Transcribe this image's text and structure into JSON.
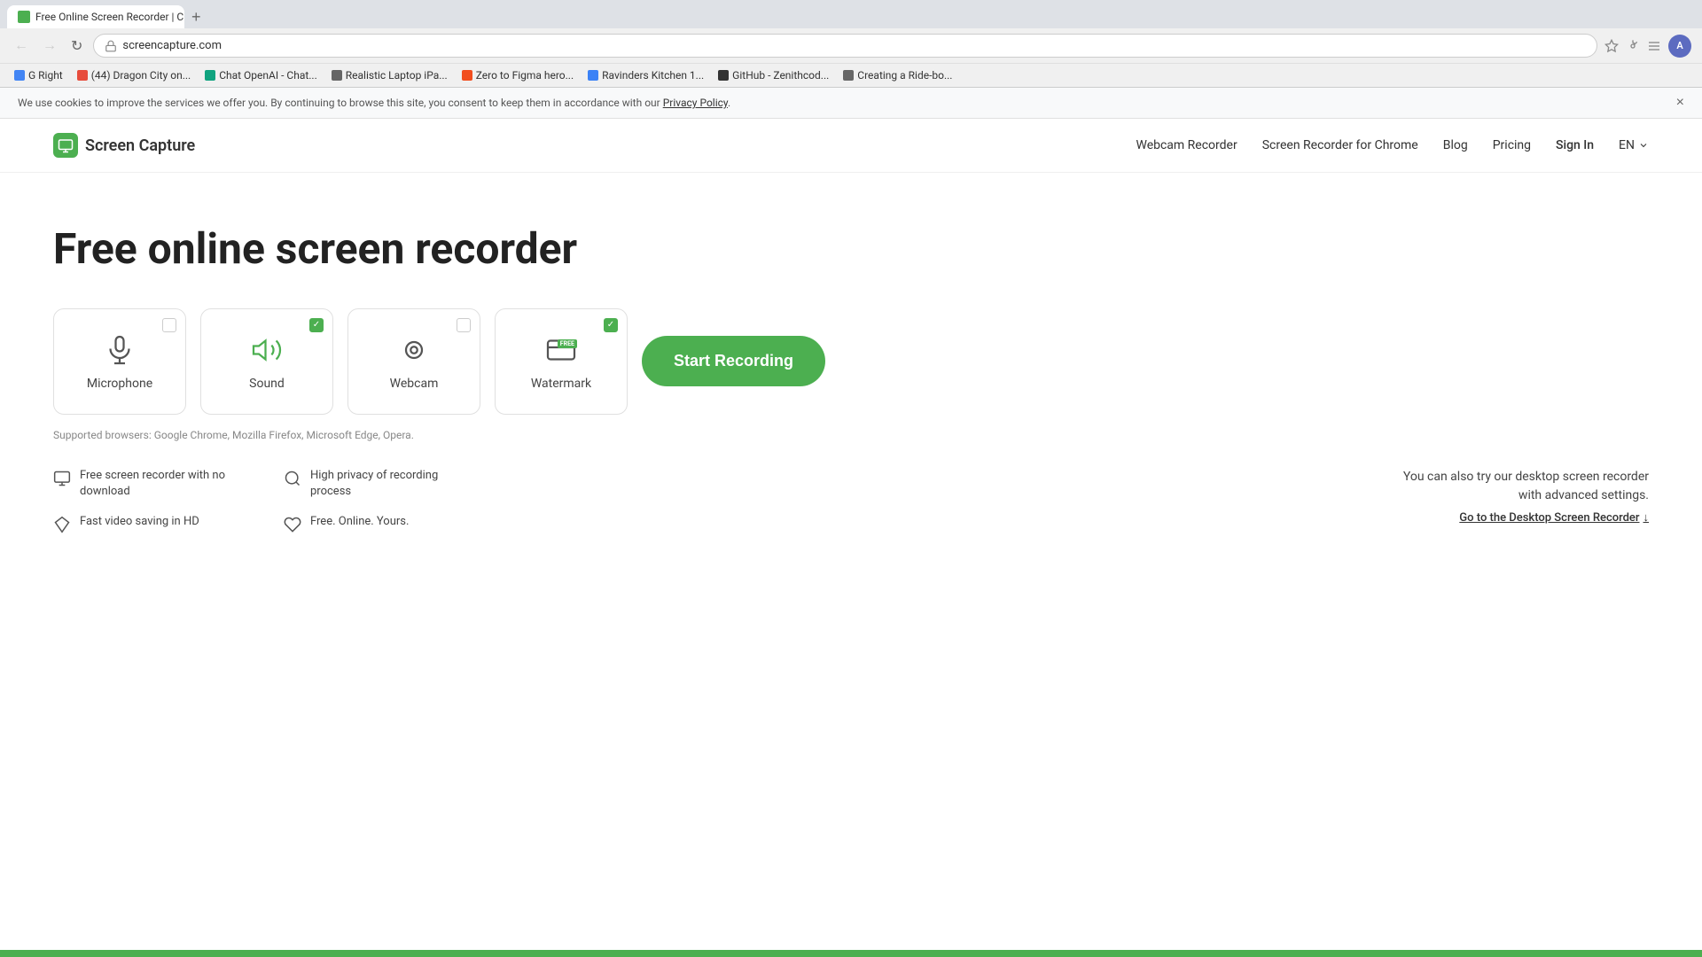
{
  "browser": {
    "tab_title": "Free Online Screen Recorder | C...",
    "tab_new_label": "+",
    "nav_back": "←",
    "nav_forward": "→",
    "nav_refresh": "↻",
    "url": "screencapture.com",
    "bookmarks": [
      {
        "label": "G Right",
        "color": "#4285f4"
      },
      {
        "label": "(44) Dragon City on...",
        "color": "#e74c3c"
      },
      {
        "label": "Chat OpenAI - Chat...",
        "color": "#10a37f"
      },
      {
        "label": "Realistic Laptop iPa...",
        "color": "#666"
      },
      {
        "label": "Zero to Figma hero...",
        "color": "#f24e1e"
      },
      {
        "label": "Ravinders Kitchen 1...",
        "color": "#3b82f6"
      },
      {
        "label": "GitHub - Zenithcod...",
        "color": "#333"
      },
      {
        "label": "Creating a Ride-bo...",
        "color": "#666"
      }
    ]
  },
  "cookie_banner": {
    "text": "We use cookies to improve the services we offer you. By continuing to browse this site, you consent to keep them in accordance with our",
    "link_text": "Privacy Policy",
    "close_label": "×"
  },
  "navbar": {
    "logo_text": "Screen Capture",
    "links": [
      {
        "label": "Webcam Recorder"
      },
      {
        "label": "Screen Recorder for Chrome"
      },
      {
        "label": "Blog"
      },
      {
        "label": "Pricing"
      },
      {
        "label": "Sign In"
      },
      {
        "label": "EN"
      }
    ]
  },
  "hero": {
    "title": "Free online screen recorder"
  },
  "options": [
    {
      "id": "microphone",
      "label": "Microphone",
      "checked": false
    },
    {
      "id": "sound",
      "label": "Sound",
      "checked": true
    },
    {
      "id": "webcam",
      "label": "Webcam",
      "checked": false
    },
    {
      "id": "watermark",
      "label": "Watermark",
      "checked": true
    }
  ],
  "start_button": "Start Recording",
  "supported_browsers": "Supported browsers: Google Chrome, Mozilla Firefox, Microsoft Edge, Opera.",
  "features": [
    {
      "id": "no-download",
      "label": "Free screen recorder with no download"
    },
    {
      "id": "high-privacy",
      "label": "High privacy of recording process"
    },
    {
      "id": "hd-saving",
      "label": "Fast video saving in HD"
    },
    {
      "id": "free-online",
      "label": "Free. Online. Yours."
    }
  ],
  "desktop_cta": {
    "desc": "You can also try our desktop screen recorder\nwith advanced settings.",
    "link_text": "Go to the Desktop Screen Recorder",
    "link_icon": "↓"
  }
}
